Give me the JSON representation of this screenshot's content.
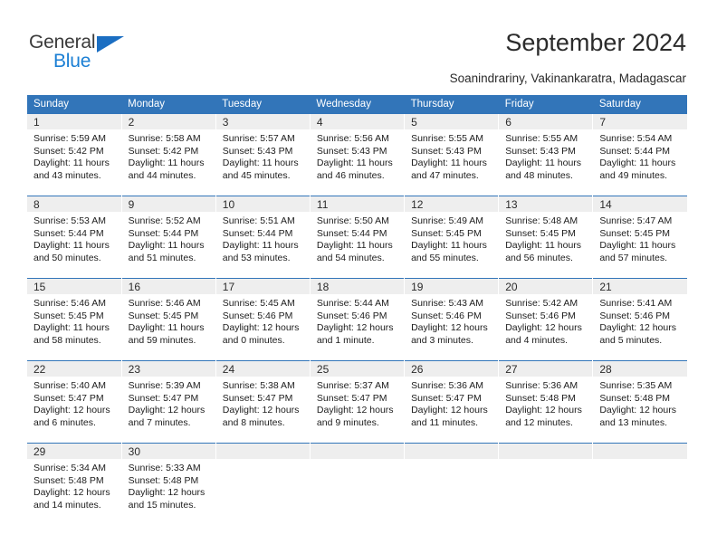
{
  "brand": {
    "name_part1": "General",
    "name_part2": "Blue",
    "triangle_color": "#1b6ec2",
    "blue_color": "#1b7fd4",
    "gray_color": "#3b3b3b"
  },
  "header": {
    "title": "September 2024",
    "subtitle": "Soanindrariny, Vakinankaratra, Madagascar"
  },
  "calendar": {
    "header_bg": "#3275b9",
    "header_text": "#ffffff",
    "daynum_band_bg": "#eeeeee",
    "weekdays": [
      "Sunday",
      "Monday",
      "Tuesday",
      "Wednesday",
      "Thursday",
      "Friday",
      "Saturday"
    ],
    "weeks": [
      [
        {
          "day": "1",
          "sunrise": "Sunrise: 5:59 AM",
          "sunset": "Sunset: 5:42 PM",
          "daylight1": "Daylight: 11 hours",
          "daylight2": "and 43 minutes."
        },
        {
          "day": "2",
          "sunrise": "Sunrise: 5:58 AM",
          "sunset": "Sunset: 5:42 PM",
          "daylight1": "Daylight: 11 hours",
          "daylight2": "and 44 minutes."
        },
        {
          "day": "3",
          "sunrise": "Sunrise: 5:57 AM",
          "sunset": "Sunset: 5:43 PM",
          "daylight1": "Daylight: 11 hours",
          "daylight2": "and 45 minutes."
        },
        {
          "day": "4",
          "sunrise": "Sunrise: 5:56 AM",
          "sunset": "Sunset: 5:43 PM",
          "daylight1": "Daylight: 11 hours",
          "daylight2": "and 46 minutes."
        },
        {
          "day": "5",
          "sunrise": "Sunrise: 5:55 AM",
          "sunset": "Sunset: 5:43 PM",
          "daylight1": "Daylight: 11 hours",
          "daylight2": "and 47 minutes."
        },
        {
          "day": "6",
          "sunrise": "Sunrise: 5:55 AM",
          "sunset": "Sunset: 5:43 PM",
          "daylight1": "Daylight: 11 hours",
          "daylight2": "and 48 minutes."
        },
        {
          "day": "7",
          "sunrise": "Sunrise: 5:54 AM",
          "sunset": "Sunset: 5:44 PM",
          "daylight1": "Daylight: 11 hours",
          "daylight2": "and 49 minutes."
        }
      ],
      [
        {
          "day": "8",
          "sunrise": "Sunrise: 5:53 AM",
          "sunset": "Sunset: 5:44 PM",
          "daylight1": "Daylight: 11 hours",
          "daylight2": "and 50 minutes."
        },
        {
          "day": "9",
          "sunrise": "Sunrise: 5:52 AM",
          "sunset": "Sunset: 5:44 PM",
          "daylight1": "Daylight: 11 hours",
          "daylight2": "and 51 minutes."
        },
        {
          "day": "10",
          "sunrise": "Sunrise: 5:51 AM",
          "sunset": "Sunset: 5:44 PM",
          "daylight1": "Daylight: 11 hours",
          "daylight2": "and 53 minutes."
        },
        {
          "day": "11",
          "sunrise": "Sunrise: 5:50 AM",
          "sunset": "Sunset: 5:44 PM",
          "daylight1": "Daylight: 11 hours",
          "daylight2": "and 54 minutes."
        },
        {
          "day": "12",
          "sunrise": "Sunrise: 5:49 AM",
          "sunset": "Sunset: 5:45 PM",
          "daylight1": "Daylight: 11 hours",
          "daylight2": "and 55 minutes."
        },
        {
          "day": "13",
          "sunrise": "Sunrise: 5:48 AM",
          "sunset": "Sunset: 5:45 PM",
          "daylight1": "Daylight: 11 hours",
          "daylight2": "and 56 minutes."
        },
        {
          "day": "14",
          "sunrise": "Sunrise: 5:47 AM",
          "sunset": "Sunset: 5:45 PM",
          "daylight1": "Daylight: 11 hours",
          "daylight2": "and 57 minutes."
        }
      ],
      [
        {
          "day": "15",
          "sunrise": "Sunrise: 5:46 AM",
          "sunset": "Sunset: 5:45 PM",
          "daylight1": "Daylight: 11 hours",
          "daylight2": "and 58 minutes."
        },
        {
          "day": "16",
          "sunrise": "Sunrise: 5:46 AM",
          "sunset": "Sunset: 5:45 PM",
          "daylight1": "Daylight: 11 hours",
          "daylight2": "and 59 minutes."
        },
        {
          "day": "17",
          "sunrise": "Sunrise: 5:45 AM",
          "sunset": "Sunset: 5:46 PM",
          "daylight1": "Daylight: 12 hours",
          "daylight2": "and 0 minutes."
        },
        {
          "day": "18",
          "sunrise": "Sunrise: 5:44 AM",
          "sunset": "Sunset: 5:46 PM",
          "daylight1": "Daylight: 12 hours",
          "daylight2": "and 1 minute."
        },
        {
          "day": "19",
          "sunrise": "Sunrise: 5:43 AM",
          "sunset": "Sunset: 5:46 PM",
          "daylight1": "Daylight: 12 hours",
          "daylight2": "and 3 minutes."
        },
        {
          "day": "20",
          "sunrise": "Sunrise: 5:42 AM",
          "sunset": "Sunset: 5:46 PM",
          "daylight1": "Daylight: 12 hours",
          "daylight2": "and 4 minutes."
        },
        {
          "day": "21",
          "sunrise": "Sunrise: 5:41 AM",
          "sunset": "Sunset: 5:46 PM",
          "daylight1": "Daylight: 12 hours",
          "daylight2": "and 5 minutes."
        }
      ],
      [
        {
          "day": "22",
          "sunrise": "Sunrise: 5:40 AM",
          "sunset": "Sunset: 5:47 PM",
          "daylight1": "Daylight: 12 hours",
          "daylight2": "and 6 minutes."
        },
        {
          "day": "23",
          "sunrise": "Sunrise: 5:39 AM",
          "sunset": "Sunset: 5:47 PM",
          "daylight1": "Daylight: 12 hours",
          "daylight2": "and 7 minutes."
        },
        {
          "day": "24",
          "sunrise": "Sunrise: 5:38 AM",
          "sunset": "Sunset: 5:47 PM",
          "daylight1": "Daylight: 12 hours",
          "daylight2": "and 8 minutes."
        },
        {
          "day": "25",
          "sunrise": "Sunrise: 5:37 AM",
          "sunset": "Sunset: 5:47 PM",
          "daylight1": "Daylight: 12 hours",
          "daylight2": "and 9 minutes."
        },
        {
          "day": "26",
          "sunrise": "Sunrise: 5:36 AM",
          "sunset": "Sunset: 5:47 PM",
          "daylight1": "Daylight: 12 hours",
          "daylight2": "and 11 minutes."
        },
        {
          "day": "27",
          "sunrise": "Sunrise: 5:36 AM",
          "sunset": "Sunset: 5:48 PM",
          "daylight1": "Daylight: 12 hours",
          "daylight2": "and 12 minutes."
        },
        {
          "day": "28",
          "sunrise": "Sunrise: 5:35 AM",
          "sunset": "Sunset: 5:48 PM",
          "daylight1": "Daylight: 12 hours",
          "daylight2": "and 13 minutes."
        }
      ],
      [
        {
          "day": "29",
          "sunrise": "Sunrise: 5:34 AM",
          "sunset": "Sunset: 5:48 PM",
          "daylight1": "Daylight: 12 hours",
          "daylight2": "and 14 minutes."
        },
        {
          "day": "30",
          "sunrise": "Sunrise: 5:33 AM",
          "sunset": "Sunset: 5:48 PM",
          "daylight1": "Daylight: 12 hours",
          "daylight2": "and 15 minutes."
        },
        {
          "day": "",
          "sunrise": "",
          "sunset": "",
          "daylight1": "",
          "daylight2": ""
        },
        {
          "day": "",
          "sunrise": "",
          "sunset": "",
          "daylight1": "",
          "daylight2": ""
        },
        {
          "day": "",
          "sunrise": "",
          "sunset": "",
          "daylight1": "",
          "daylight2": ""
        },
        {
          "day": "",
          "sunrise": "",
          "sunset": "",
          "daylight1": "",
          "daylight2": ""
        },
        {
          "day": "",
          "sunrise": "",
          "sunset": "",
          "daylight1": "",
          "daylight2": ""
        }
      ]
    ]
  }
}
